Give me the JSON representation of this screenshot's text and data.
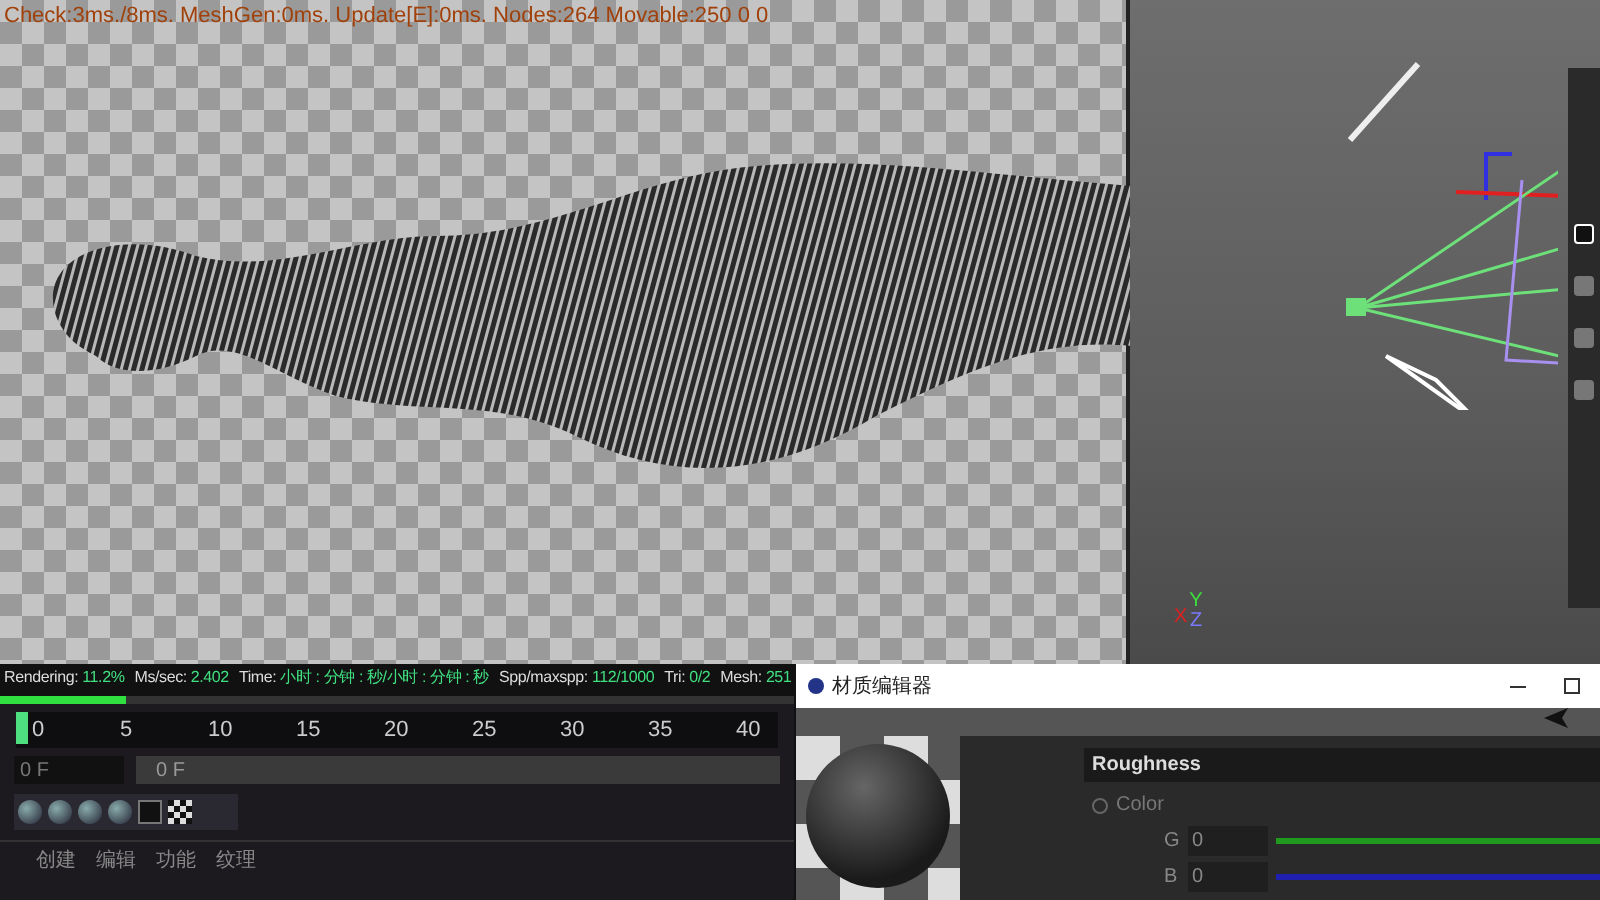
{
  "viewport_stats": "Check:3ms./8ms. MeshGen:0ms. Update[E]:0ms. Nodes:264 Movable:250  0 0",
  "render_stats": {
    "items": [
      {
        "label": "Rendering:",
        "value": "11.2%"
      },
      {
        "label": "Ms/sec:",
        "value": "2.402"
      },
      {
        "label": "Time:",
        "value": "小时 : 分钟 : 秒/小时 : 分钟 : 秒"
      },
      {
        "label": "Spp/maxspp:",
        "value": "112/1000"
      },
      {
        "label": "Tri:",
        "value": "0/2"
      },
      {
        "label": "Mesh:",
        "value": "251"
      }
    ],
    "level": 0.112
  },
  "timeline": {
    "ticks": [
      "0",
      "5",
      "10",
      "15",
      "20",
      "25",
      "30",
      "35",
      "40"
    ]
  },
  "frame_fields": [
    "0 F",
    "0 F"
  ],
  "material_menu": [
    "创建",
    "编辑",
    "功能",
    "纹理"
  ],
  "axis": {
    "y": "Y",
    "x": "X",
    "z": "Z"
  },
  "side_checkboxes": [
    {
      "checked": true
    },
    {
      "checked": false
    },
    {
      "checked": false
    },
    {
      "checked": false
    }
  ],
  "material_editor": {
    "title": "材质编辑器",
    "section": "Roughness",
    "radio": {
      "label": "Color",
      "selected": false
    },
    "channels": [
      {
        "label": "G",
        "value": "0",
        "color": "#1f9a1f"
      },
      {
        "label": "B",
        "value": "0",
        "color": "#1f1fb0"
      }
    ]
  }
}
